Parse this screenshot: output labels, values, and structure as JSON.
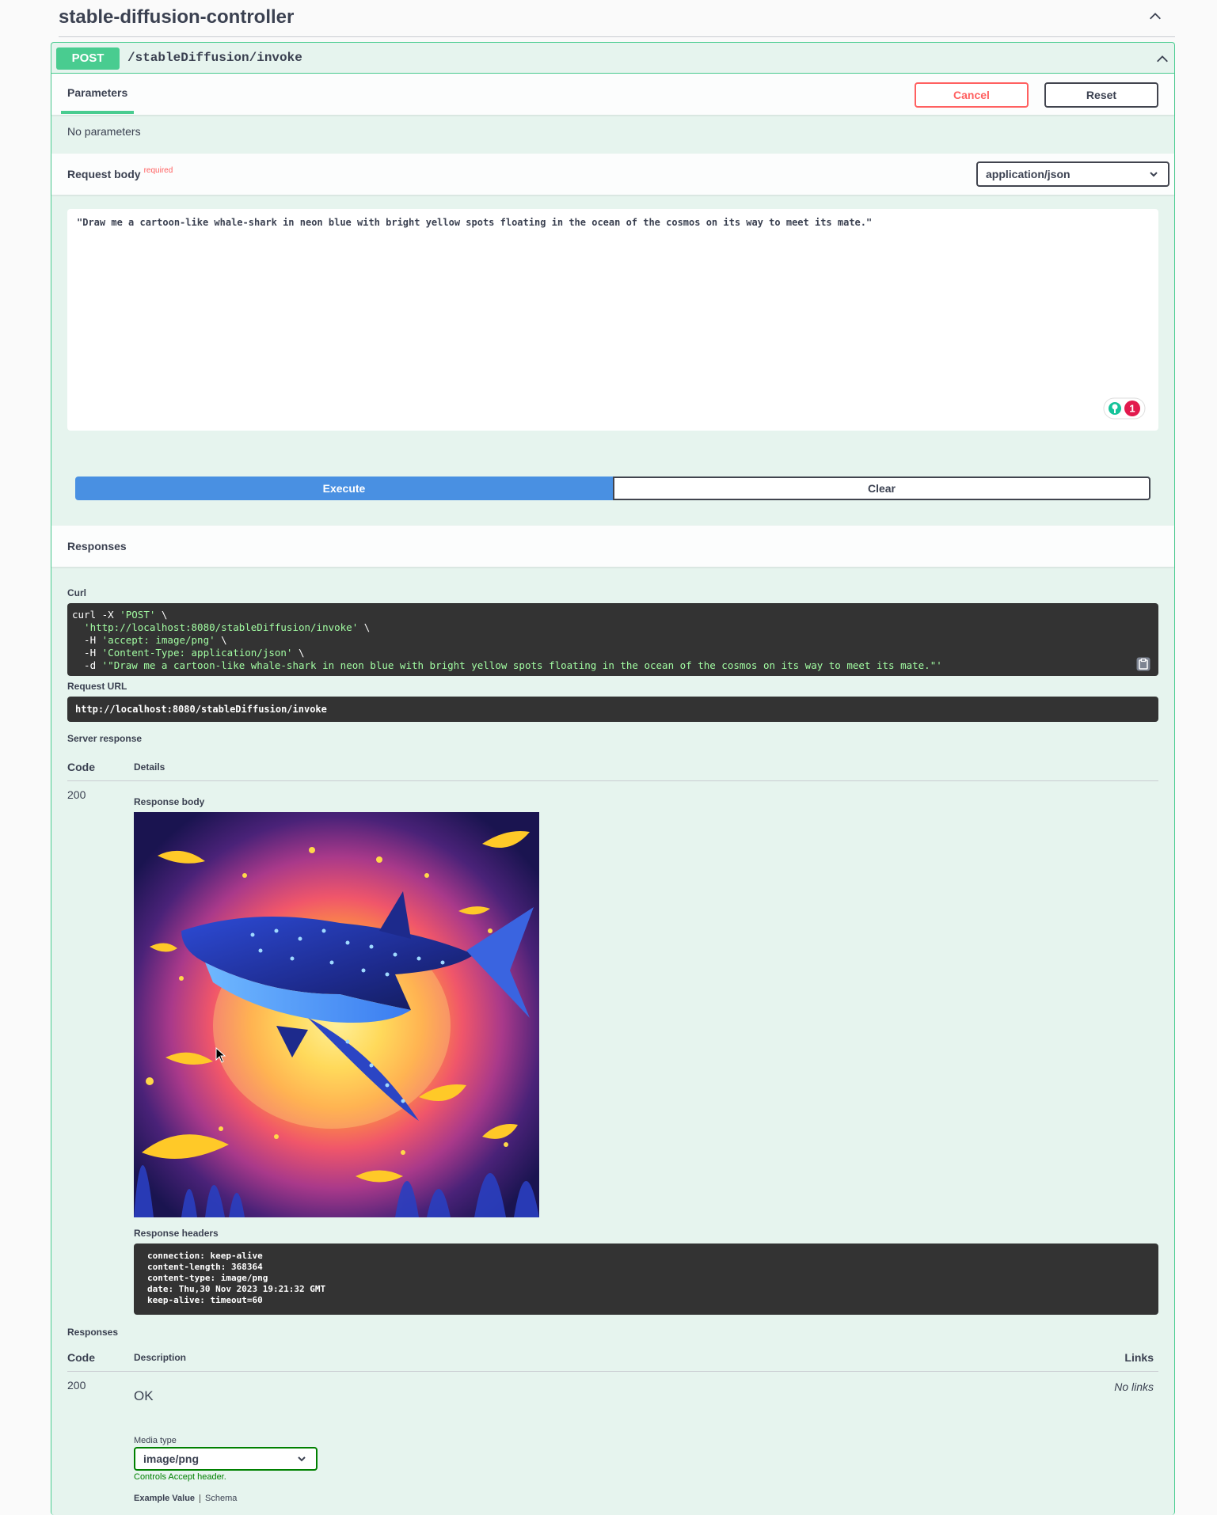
{
  "tag": {
    "title": "stable-diffusion-controller"
  },
  "operation": {
    "method": "POST",
    "path": "/stableDiffusion/invoke"
  },
  "parameters": {
    "tab_label": "Parameters",
    "cancel_label": "Cancel",
    "reset_label": "Reset",
    "empty_text": "No parameters"
  },
  "request_body": {
    "title": "Request body",
    "required_label": "required",
    "content_type": "application/json",
    "value": "\"Draw me a cartoon-like whale-shark in neon blue with bright yellow spots floating in the ocean of the cosmos on its way to meet its mate.\"",
    "badge_count": "1"
  },
  "actions": {
    "execute_label": "Execute",
    "clear_label": "Clear"
  },
  "responses": {
    "title": "Responses",
    "curl_label": "Curl",
    "curl": {
      "line1_cmd": "curl -X ",
      "line1_str": "'POST'",
      "line1_end": " \\",
      "line2_str": "  'http://localhost:8080/stableDiffusion/invoke'",
      "line2_end": " \\",
      "line3_cmd": "  -H ",
      "line3_str": "'accept: image/png'",
      "line3_end": " \\",
      "line4_cmd": "  -H ",
      "line4_str": "'Content-Type: application/json'",
      "line4_end": " \\",
      "line5_cmd": "  -d ",
      "line5_str": "'\"Draw me a cartoon-like whale-shark in neon blue with bright yellow spots floating in the ocean of the cosmos on its way to meet its mate.\"'"
    },
    "request_url_label": "Request URL",
    "request_url": "http://localhost:8080/stableDiffusion/invoke",
    "server_response_label": "Server response",
    "code_header": "Code",
    "details_header": "Details",
    "response_code": "200",
    "response_body_label": "Response body",
    "response_headers_label": "Response headers",
    "response_headers": [
      "connection: keep-alive",
      "content-length: 368364",
      "content-type: image/png",
      "date: Thu,30 Nov 2023 19:21:32 GMT",
      "keep-alive: timeout=60"
    ]
  },
  "documented_responses": {
    "title": "Responses",
    "code_header": "Code",
    "description_header": "Description",
    "links_header": "Links",
    "code": "200",
    "description": "OK",
    "links": "No links",
    "media_type_label": "Media type",
    "media_type": "image/png",
    "accept_note": "Controls Accept header.",
    "tab_example": "Example Value",
    "tab_schema": "Schema"
  },
  "colors": {
    "post_green": "#49cc90",
    "execute_blue": "#4990e2",
    "cancel_red": "#ff6060",
    "code_bg": "#333333",
    "opblock_bg": "#e6f4ee"
  }
}
